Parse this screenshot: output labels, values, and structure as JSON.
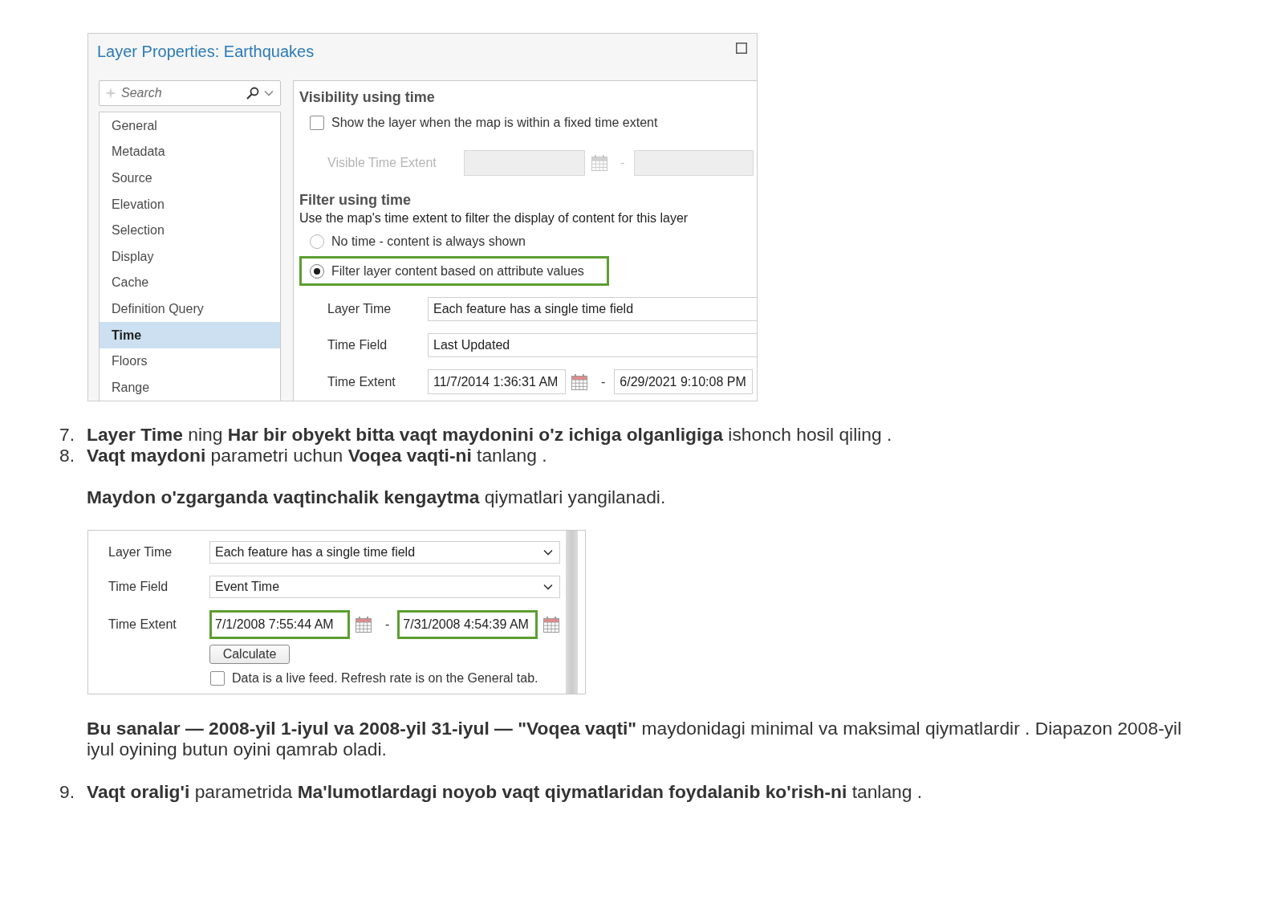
{
  "dialog": {
    "title": "Layer Properties: Earthquakes",
    "search": {
      "placeholder": "Search"
    },
    "nav_items": [
      {
        "label": "General",
        "selected": false
      },
      {
        "label": "Metadata",
        "selected": false
      },
      {
        "label": "Source",
        "selected": false
      },
      {
        "label": "Elevation",
        "selected": false
      },
      {
        "label": "Selection",
        "selected": false
      },
      {
        "label": "Display",
        "selected": false
      },
      {
        "label": "Cache",
        "selected": false
      },
      {
        "label": "Definition Query",
        "selected": false
      },
      {
        "label": "Time",
        "selected": true
      },
      {
        "label": "Floors",
        "selected": false
      },
      {
        "label": "Range",
        "selected": false
      }
    ],
    "visibility": {
      "heading": "Visibility using time",
      "fixed_extent": {
        "label": "Show the layer when the map is within a fixed time extent",
        "checked": false
      },
      "visible_extent": {
        "label": "Visible Time Extent",
        "disabled": true,
        "start": {
          "calendar": true
        },
        "separator": "-",
        "end": {
          "calendar": false
        }
      }
    },
    "filter": {
      "heading": "Filter using time",
      "description": "Use the map's time extent to filter the display of content for this layer",
      "options": [
        {
          "label": "No time - content is always shown",
          "selected": false,
          "highlighted": false
        },
        {
          "label": "Filter layer content based on attribute values",
          "selected": true,
          "highlighted": true
        }
      ],
      "fields": [
        {
          "kind": "field",
          "label": "Layer Time",
          "value": "Each feature has a single time field"
        },
        {
          "kind": "field",
          "label": "Time Field",
          "value": "Last Updated"
        },
        {
          "kind": "range",
          "label": "Time Extent",
          "start": {
            "value": "11/7/2014 1:36:31 AM",
            "calendar": true
          },
          "separator": "-",
          "end": {
            "value": "6/29/2021 9:10:08 PM",
            "calendar": false
          }
        }
      ]
    }
  },
  "steps": [
    {
      "number": "7.",
      "text": "**Layer Time** ning **Har bir obyekt bitta vaqt maydonini o'z ichiga olganligiga** ishonch hosil qiling ."
    },
    {
      "number": "8.",
      "text": "**Vaqt maydoni** parametri uchun **Voqea vaqti-ni** tanlang ."
    }
  ],
  "note": "**Maydon o'zgarganda vaqtinchalik kengaytma** qiymatlari yangilanadi.",
  "time_panel": {
    "fields": [
      {
        "kind": "select",
        "label": "Layer Time",
        "value": "Each feature has a single time field"
      },
      {
        "kind": "select",
        "label": "Time Field",
        "value": "Event Time"
      },
      {
        "kind": "range",
        "label": "Time Extent",
        "start": {
          "value": "7/1/2008 7:55:44 AM",
          "calendar": true,
          "highlighted": true
        },
        "separator": "-",
        "end": {
          "value": "7/31/2008 4:54:39 AM",
          "calendar": true,
          "highlighted": true
        }
      }
    ],
    "calculate_button": "Calculate",
    "live_feed": {
      "label": "Data is a live feed. Refresh rate is on the General tab.",
      "checked": false
    }
  },
  "explanation": "**Bu sanalar — 2008-yil 1-iyul va 2008-yil 31-iyul — \"Voqea vaqti\"** maydonidagi minimal va maksimal qiymatlardir . Diapazon 2008-yil iyul oyining butun oyini qamrab oladi.",
  "final_steps": [
    {
      "number": "9.",
      "text": "**Vaqt oralig'i** parametrida **Ma'lumotlardagi noyob vaqt qiymatlaridan foydalanib ko'rish-ni** tanlang ."
    }
  ]
}
